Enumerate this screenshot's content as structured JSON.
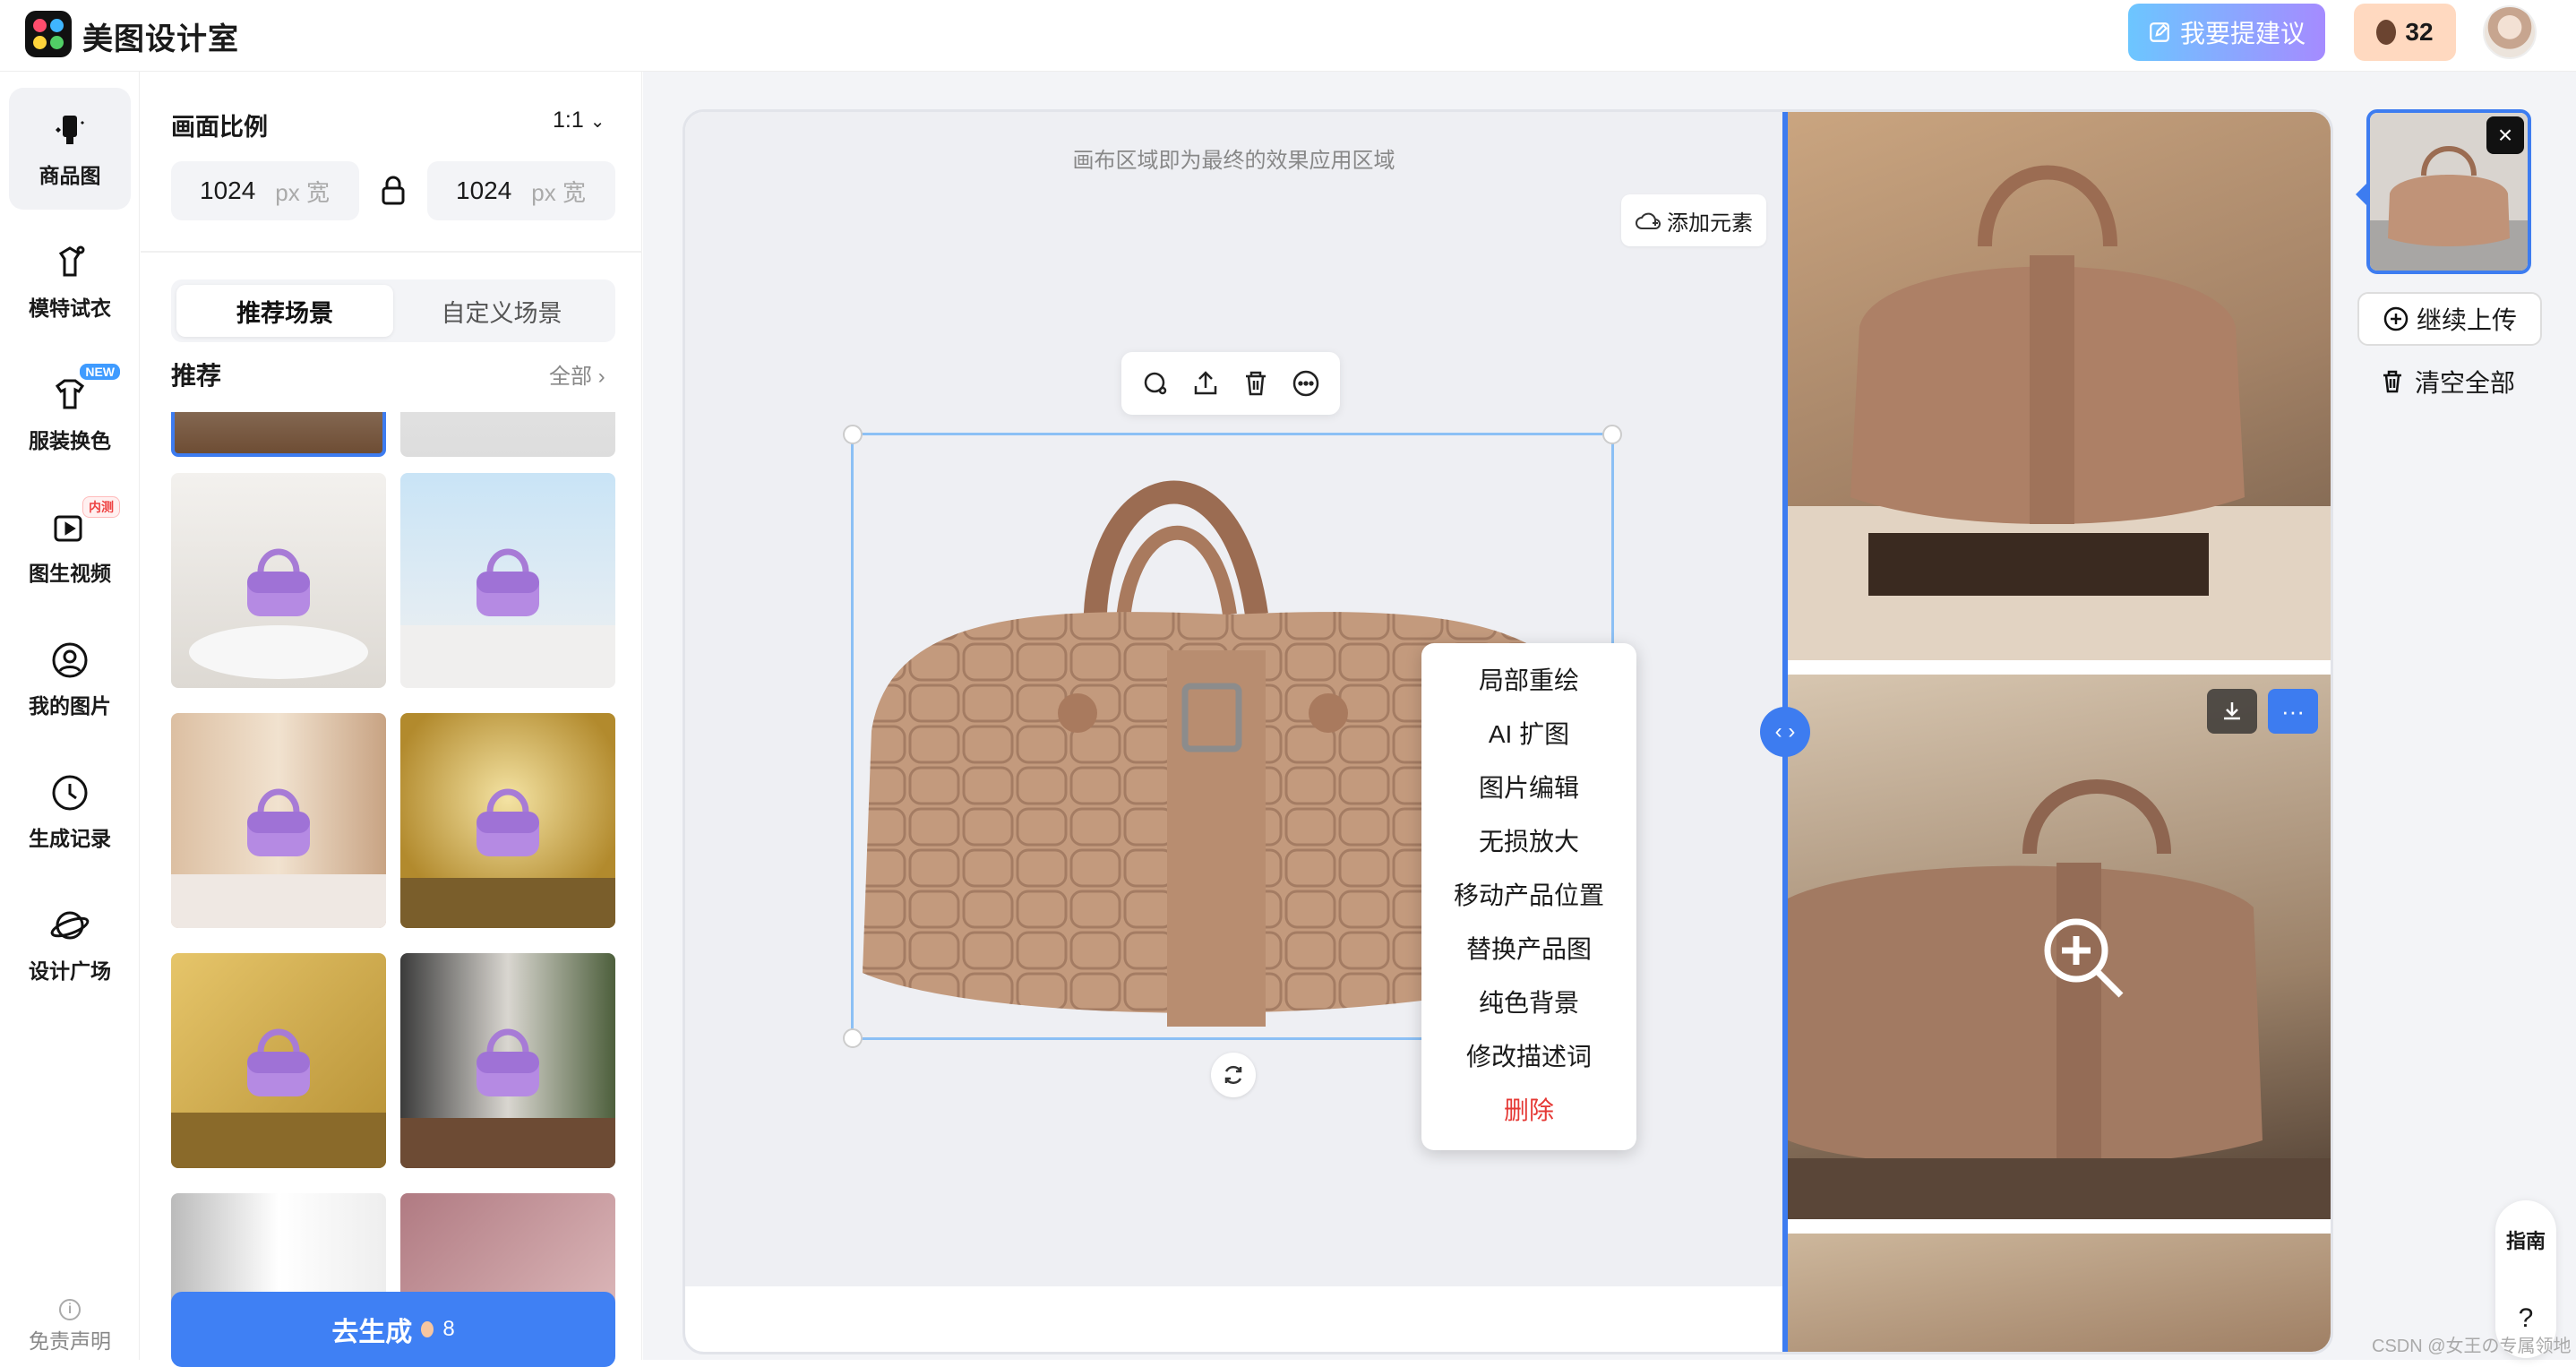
{
  "header": {
    "app_name": "美图设计室",
    "suggest_label": "我要提建议",
    "credits": "32"
  },
  "rail": {
    "items": [
      {
        "label": "商品图"
      },
      {
        "label": "模特试衣"
      },
      {
        "label": "服装换色",
        "tag": "NEW"
      },
      {
        "label": "图生视频",
        "tag": "内测"
      },
      {
        "label": "我的图片"
      },
      {
        "label": "生成记录"
      },
      {
        "label": "设计广场"
      }
    ],
    "disclaimer": "免责声明"
  },
  "panel": {
    "ratio_label": "画面比例",
    "ratio_value": "1:1",
    "width_value": "1024",
    "width_unit": "px 宽",
    "height_value": "1024",
    "height_unit": "px 宽",
    "tabs": [
      "推荐场景",
      "自定义场景"
    ],
    "recommend_title": "推荐",
    "recommend_all": "全部",
    "generate_label": "去生成",
    "generate_cost": "8"
  },
  "canvas": {
    "hint": "画布区域即为最终的效果应用区域",
    "add_element": "添加元素"
  },
  "context_menu": {
    "items": [
      "局部重绘",
      "AI 扩图",
      "图片编辑",
      "无损放大",
      "移动产品位置",
      "替换产品图",
      "纯色背景",
      "修改描述词"
    ],
    "delete": "删除"
  },
  "right": {
    "upload_more": "继续上传",
    "clear_all": "清空全部",
    "guide": "指南",
    "help": "?"
  },
  "watermark": "CSDN @女王の专属领地",
  "colors": {
    "accent": "#3d7cf0",
    "danger": "#e53935",
    "leather": "#b88a6e"
  }
}
